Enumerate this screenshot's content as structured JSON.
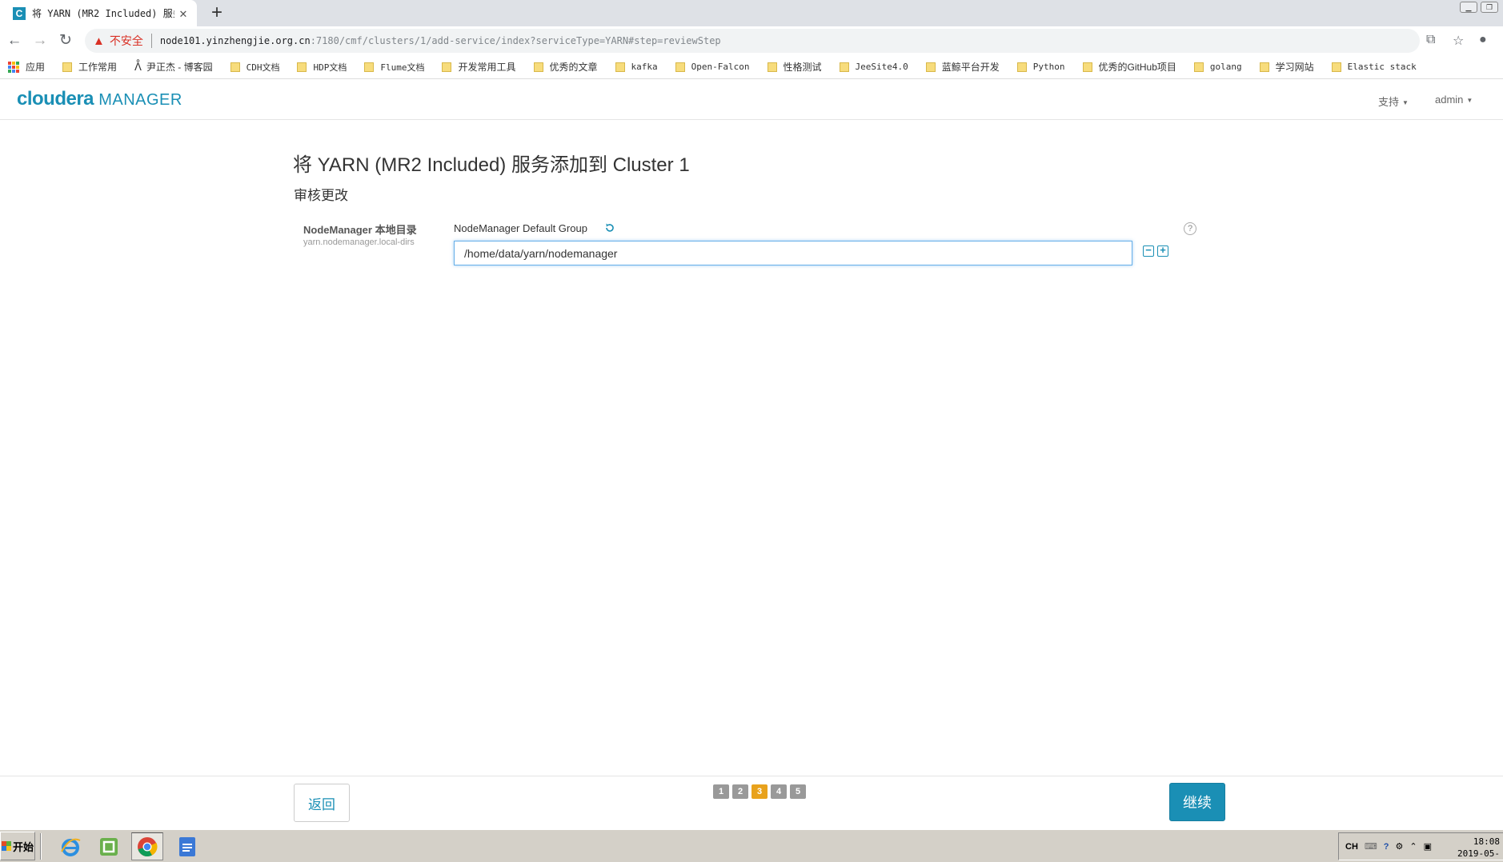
{
  "browser": {
    "tab_title": "将 YARN (MR2 Included) 服务添",
    "tab_favicon_letter": "C",
    "new_tab": "+",
    "close_tab": "✕",
    "security_label": "不安全",
    "url_host": "node101.yinzhengjie.org.cn",
    "url_rest": ":7180/cmf/clusters/1/add-service/index?serviceType=YARN#step=reviewStep"
  },
  "bookmarks": {
    "apps": "应用",
    "items": [
      "工作常用",
      "尹正杰 - 博客园",
      "CDH文档",
      "HDP文档",
      "Flume文档",
      "开发常用工具",
      "优秀的文章",
      "kafka",
      "Open-Falcon",
      "性格测试",
      "JeeSite4.0",
      "蓝鲸平台开发",
      "Python",
      "优秀的GitHub项目",
      "golang",
      "学习网站",
      "Elastic stack"
    ]
  },
  "header": {
    "logo_brand": "cloudera",
    "logo_product": "MANAGER",
    "support_menu": "支持",
    "user_menu": "admin"
  },
  "main": {
    "title": "将 YARN (MR2 Included) 服务添加到 Cluster 1",
    "subtitle": "审核更改",
    "property_label": "NodeManager 本地目录",
    "property_key": "yarn.nodemanager.local-dirs",
    "group_label": "NodeManager Default Group",
    "dir_value": "/home/data/yarn/nodemanager",
    "help": "?",
    "minus": "−",
    "plus": "+"
  },
  "footer": {
    "back_label": "返回",
    "continue_label": "继续",
    "steps": [
      "1",
      "2",
      "3",
      "4",
      "5"
    ],
    "active_step": 3
  },
  "taskbar": {
    "start_label": "开始",
    "lang": "CH",
    "time": "18:08",
    "date": "2019-05-"
  },
  "colors": {
    "accent": "#1a8fb5",
    "step_active": "#e8a21c",
    "step_inactive": "#999999"
  }
}
